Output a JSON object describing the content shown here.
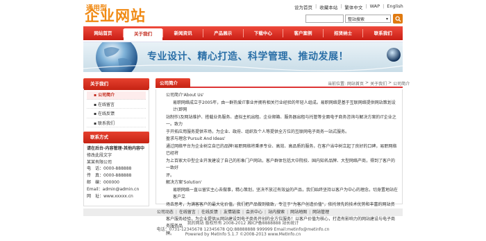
{
  "logo": {
    "top": "通用型",
    "main": "企业网站"
  },
  "toplinks": [
    "设为首页",
    "收藏本站",
    "繁体中文",
    "WAP",
    "English"
  ],
  "search": {
    "select_value": "整站搜索"
  },
  "nav": [
    "网站首页",
    "关于我们",
    "新闻资讯",
    "产品展示",
    "下载中心",
    "客户案例",
    "招贤纳士",
    "联系我们"
  ],
  "banner": {
    "slogan": "专业设计、精心打造、科学管理、推动发展！"
  },
  "sidebar": {
    "about_title": "关于我们",
    "items": [
      "公司简介",
      "在线留言",
      "在线反馈",
      "联系我们"
    ],
    "contact_title": "联系方式",
    "contact_lines": [
      "请在后台-内容管理-其他内容中",
      "修改此段文字",
      "某某有限公司",
      "电　话：0000-888888",
      "传　真：0000-888888",
      "邮　编：000000",
      "Email：admin@admin.cn",
      "网　址：www.xxxxx.cn"
    ]
  },
  "main": {
    "tab": "公司简介",
    "breadcrumb": [
      "当前位置:",
      "网站首页",
      ">",
      "关于我们",
      ">",
      "公司简介"
    ],
    "paragraphs": [
      "公司简介'About Us'",
      "易职网络成立于2005年，由一群热爱IT事业并拥有相关行业经验的年轻人组成。易职网络是基于互联网络提供网站策划设计(即网",
      "站制作)及网站维护、搭载业务服务、虚拟主机出租、企业邮箱、服务器出租与托管等全面电子商务咨询与解决方案的IT企业之一。致力",
      "于开拓应用服务提供市场，为企业、政府、组织及个人等提供全方位的互联网电子商务一站式服务。",
      "盈求与理念'Pursuit And Ideas'",
      "通过网络平台为企业树立自已的品牌!易职网络将秉承专业、高效、高品质的服务，在客户当中树立起了良好的口碑，易职网络已经将",
      "为上百家大中型企业开发建设了自己的形象门户网站，客户群体包括大中院校、国内知名品牌、大型网络产商，得到了客户的一致好",
      "评。",
      "解决方案'Solution'",
      "易职网络一直以留实主心去做事，精心策划，坚决不放过有效益的产品，我们始终坚持以客户为中心的理念，切身置地站在客户立",
      "场去思考，为满客客户的最大化价值。我们把产品做到极致，专注于\"为客户创造价值\"，依托领先的技术优势和丰富的网站资源，规范化的",
      "客户服务经验，为企业提供从网站建设到电子商务开创的全方位服务！以客户价值为核心，打造有影响力的网站建设与电子商务服务品",
      "牌。"
    ]
  },
  "footer": {
    "links": [
      "公司动态",
      "在线留言",
      "在线反馈",
      "友情链接",
      "会员中心",
      "站内搜索",
      "网站地图",
      "网站管理"
    ],
    "line1": "我的网站 版权所有 2008-2012 湘ICP备8888888 站长统计",
    "line2": "电话：0731-12345678 12345678 QQ:88888888 999999 Email:metinfo@metinfo.cn",
    "line3": "Powered by MetInfo 5.1.7 ©2008-2013 www.MetInfo.cn"
  },
  "colors": {
    "accent_red": "#c91d14",
    "brand_orange": "#f08a14",
    "slogan_blue": "#2b6fa7"
  }
}
